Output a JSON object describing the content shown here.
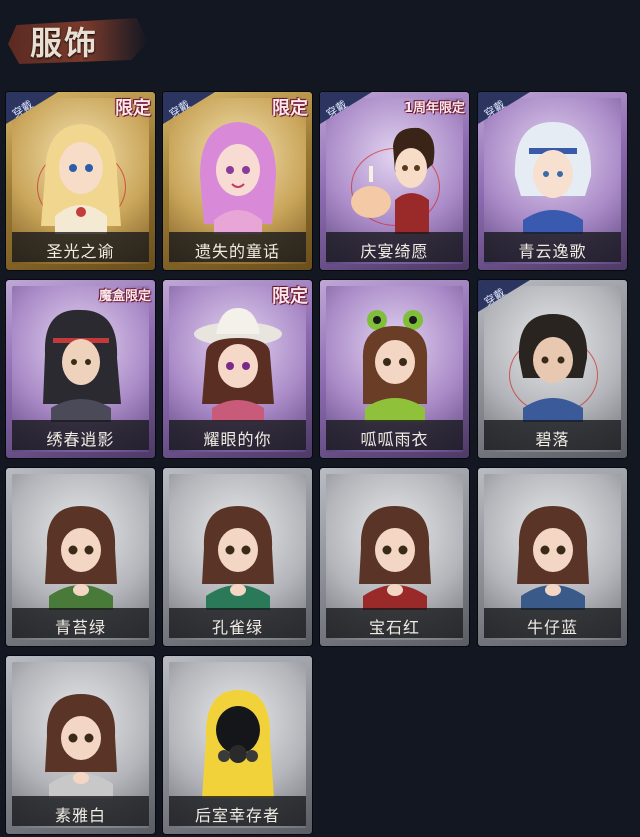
{
  "header": {
    "title": "服饰"
  },
  "outfits": [
    {
      "name": "圣光之谕",
      "frame": "gold",
      "tag": "限定",
      "wearing": true,
      "icon": "blonde-girl-portrait"
    },
    {
      "name": "遗失的童话",
      "frame": "gold",
      "tag": "限定",
      "wearing": true,
      "icon": "pink-hair-girl-portrait"
    },
    {
      "name": "庆宴绮愿",
      "frame": "purple",
      "tag": "1周年限定",
      "wearing": true,
      "icon": "cake-birthday-portrait"
    },
    {
      "name": "青云逸歌",
      "frame": "purple",
      "tag": "",
      "wearing": true,
      "icon": "white-hair-portrait"
    },
    {
      "name": "绣春逍影",
      "frame": "purple",
      "tag": "魔盒限定",
      "wearing": false,
      "icon": "swordsman-portrait"
    },
    {
      "name": "耀眼的你",
      "frame": "purple",
      "tag": "限定",
      "wearing": false,
      "icon": "cowgirl-hat-portrait"
    },
    {
      "name": "呱呱雨衣",
      "frame": "purple",
      "tag": "",
      "wearing": false,
      "icon": "frog-raincoat-portrait"
    },
    {
      "name": "碧落",
      "frame": "gray",
      "tag": "",
      "wearing": true,
      "icon": "braided-boy-portrait"
    },
    {
      "name": "青苔绿",
      "frame": "gray",
      "tag": "",
      "wearing": false,
      "icon": "girl-green-scarf-portrait"
    },
    {
      "name": "孔雀绿",
      "frame": "gray",
      "tag": "",
      "wearing": false,
      "icon": "girl-teal-scarf-portrait"
    },
    {
      "name": "宝石红",
      "frame": "gray",
      "tag": "",
      "wearing": false,
      "icon": "girl-red-scarf-portrait"
    },
    {
      "name": "牛仔蓝",
      "frame": "gray",
      "tag": "",
      "wearing": false,
      "icon": "girl-blue-scarf-portrait"
    },
    {
      "name": "素雅白",
      "frame": "gray",
      "tag": "",
      "wearing": false,
      "icon": "girl-white-scarf-portrait"
    },
    {
      "name": "后室幸存者",
      "frame": "gray",
      "tag": "",
      "wearing": false,
      "icon": "hazmat-survivor-portrait"
    }
  ],
  "wearing_label": "穿戴",
  "colors": {
    "background": "#121722",
    "gold_frame": "#c9a55a",
    "purple_frame": "#8c6ab0",
    "gray_frame": "#8a8d94",
    "label_text": "#f0ece4"
  }
}
